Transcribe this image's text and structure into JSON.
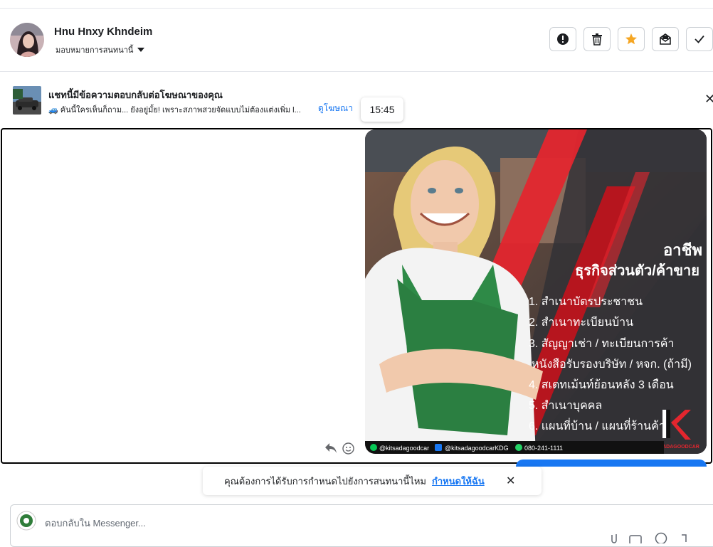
{
  "contact": {
    "name": "Hnu Hnxy Khndeim",
    "assign_label": "มอบหมายการสนทนานี้"
  },
  "toolbar": {
    "icons": [
      "alert-icon",
      "trash-icon",
      "star-icon",
      "mark-unread-icon",
      "check-icon"
    ],
    "accent_star": "#f5a623"
  },
  "ad": {
    "title": "แชทนี้มีข้อความตอบกลับต่อโฆษณาของคุณ",
    "snippet": "🚙 คันนี้ใครเห็นก็ถาม... ยังอยู่มั้ย! เพราะสภาพสวยจัดแบบไม่ต้องแต่งเพิ่ม l...",
    "link": "ดูโฆษณา",
    "time": "15:45"
  },
  "poster": {
    "heading_1": "อาชีพ",
    "heading_2": "ธุรกิจส่วนตัว/ค้าขาย",
    "items": [
      "1. สำเนาบัตรประชาชน",
      "2. สำเนาทะเบียนบ้าน",
      "3. สัญญาเช่า / ทะเบียนการค้า",
      "หนังสือรับรองบริษัท / หจก. (ถ้ามี)",
      "4. สเตทเม้นท์ย้อนหลัง 3 เดือน",
      "5. สำเนาบุคคล",
      "6. แผนที่บ้าน / แผนที่ร้านค้า"
    ],
    "footer_line": "@kitsadagoodcar",
    "footer_fb": "@kitsadagoodcarKDG",
    "footer_phone": "080-241-1111",
    "brand": "KITSADAGOODCAR",
    "brand_color": "#e3262e"
  },
  "notice": {
    "text": "คุณต้องการได้รับการกำหนดไปยังการสนทนานี้ไหม",
    "link": "กำหนดให้ฉัน"
  },
  "reply": {
    "placeholder": "ตอบกลับใน Messenger..."
  }
}
